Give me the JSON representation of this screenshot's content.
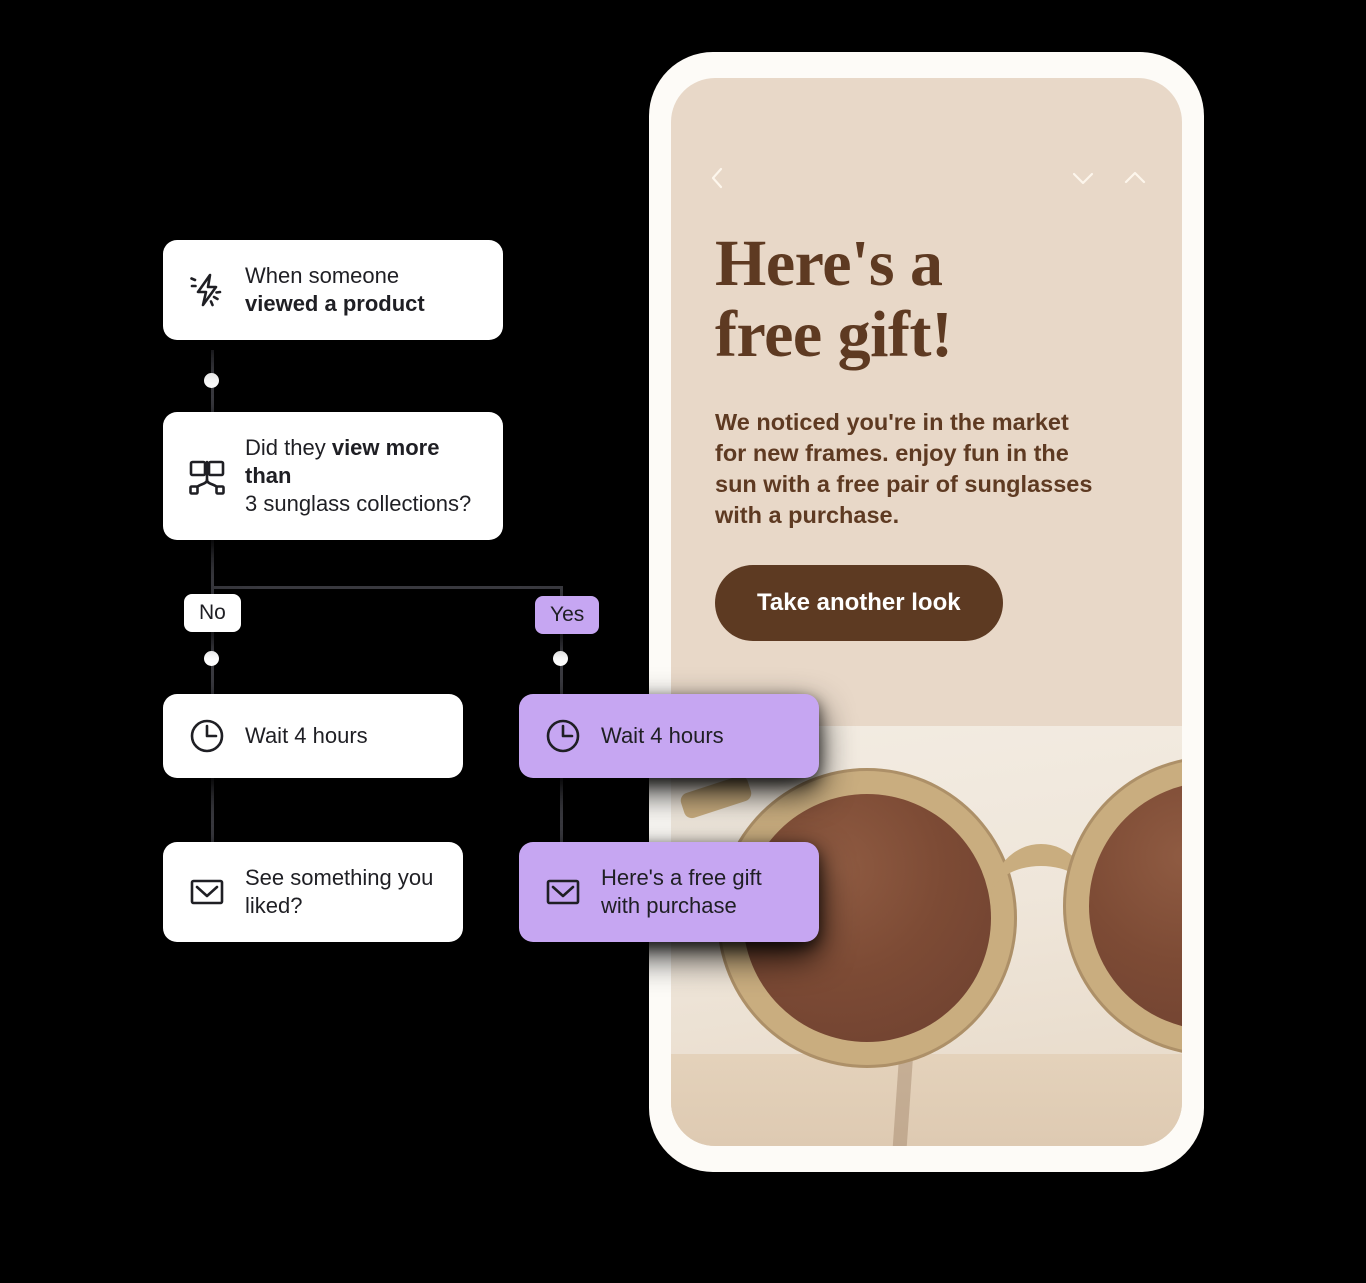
{
  "background_color": "#000000",
  "flow": {
    "cards": [
      {
        "id": "trigger",
        "icon": "lightning-bolt-icon",
        "line1": "When someone",
        "line2": "viewed a product",
        "line1_bold": false,
        "line2_bold": true,
        "style": "white"
      },
      {
        "id": "condition",
        "icon": "branch-split-icon",
        "line1_a": "Did they ",
        "line1_b": "view more than",
        "line2": "3 sunglass collections?",
        "style": "white"
      },
      {
        "id": "wait-no",
        "icon": "clock-icon",
        "label": "Wait 4 hours",
        "style": "white"
      },
      {
        "id": "wait-yes",
        "icon": "clock-icon",
        "label": "Wait 4 hours",
        "style": "purple"
      },
      {
        "id": "email-no",
        "icon": "envelope-icon",
        "line1": "See something you",
        "line2": "liked?",
        "style": "white"
      },
      {
        "id": "email-yes",
        "icon": "envelope-icon",
        "line1": "Here's a free gift",
        "line2": "with purchase",
        "style": "purple"
      }
    ],
    "branch_labels": {
      "no": "No",
      "yes": "Yes"
    },
    "colors": {
      "purple": "#c6a6f2",
      "card_white": "#ffffff",
      "connector": "#3a3a40"
    }
  },
  "phone": {
    "frame_color": "#fdfbf7",
    "screen_bg": "#e8d8c8",
    "topbar": {
      "back_icon": "chevron-left-icon",
      "down_icon": "chevron-down-icon",
      "up_icon": "chevron-up-icon"
    },
    "email": {
      "headline_line1": "Here's a",
      "headline_line2": "free gift!",
      "body": "We noticed you're in the market for new frames. enjoy fun in the sun with a free pair of sunglasses with a purchase.",
      "cta_label": "Take another look",
      "text_color": "#5e3a22",
      "cta_bg": "#5d3a22",
      "cta_text_color": "#ffffff",
      "hero_image": "sunglasses-photo"
    }
  }
}
